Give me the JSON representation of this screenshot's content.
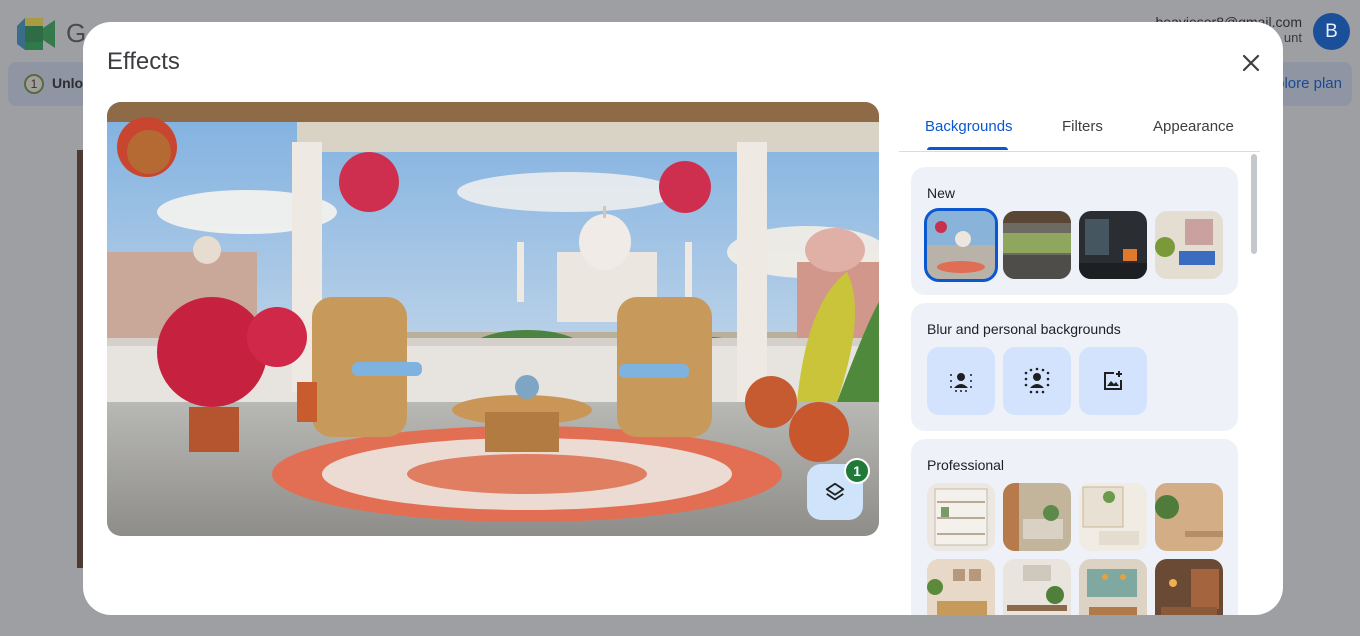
{
  "background": {
    "app_name": "G",
    "email": "beaviesor8@gmail.com",
    "account_label": "unt",
    "avatar_letter": "B",
    "banner_text": "Unlo",
    "banner_link": "plore plan"
  },
  "dialog": {
    "title": "Effects",
    "close_icon": "close-icon",
    "layers_icon": "layers-icon",
    "layers_badge": "1"
  },
  "tabs": [
    {
      "label": "Backgrounds",
      "active": true
    },
    {
      "label": "Filters",
      "active": false
    },
    {
      "label": "Appearance",
      "active": false
    }
  ],
  "sections": {
    "new": {
      "title": "New",
      "items": [
        "Taj Mahal terrace",
        "Pergola patio",
        "Modern glass room",
        "Eclectic living room"
      ],
      "selected_index": 0
    },
    "blur": {
      "title": "Blur and personal backgrounds",
      "items": [
        "slight-blur-icon",
        "blur-icon",
        "add-image-icon"
      ]
    },
    "professional": {
      "title": "Professional",
      "items": [
        "Bookshelf",
        "Wood slats",
        "Shelves with plants",
        "Wood wall",
        "Framed art wall",
        "Desk with plant",
        "Lounge with lamps",
        "Brick room"
      ]
    }
  },
  "colors": {
    "accent": "#0b57d0",
    "badge": "#1f7a3a",
    "tile_bg": "#d3e3fd",
    "section_bg": "#eef1f7"
  }
}
